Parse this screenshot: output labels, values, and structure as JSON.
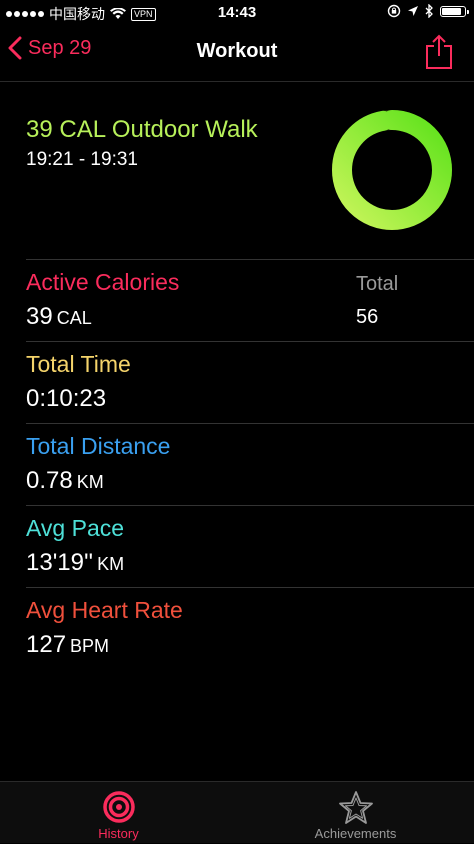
{
  "status_bar": {
    "carrier": "中国移动",
    "vpn": "VPN",
    "time": "14:43",
    "battery_level": 0.85
  },
  "nav": {
    "back_label": "Sep 29",
    "title": "Workout"
  },
  "summary": {
    "workout_name": "39 CAL Outdoor Walk",
    "time_range": "19:21 - 19:31",
    "ring_progress": 0.97
  },
  "metrics": {
    "active_calories": {
      "label": "Active Calories",
      "value": "39",
      "unit": "CAL",
      "total_label": "Total",
      "total_value": "56"
    },
    "total_time": {
      "label": "Total Time",
      "value": "0:10:23"
    },
    "total_distance": {
      "label": "Total Distance",
      "value": "0.78",
      "unit": "KM"
    },
    "avg_pace": {
      "label": "Avg Pace",
      "value": "13'19''",
      "unit": "KM"
    },
    "avg_heart_rate": {
      "label": "Avg Heart Rate",
      "value": "127",
      "unit": "BPM"
    }
  },
  "tabs": [
    {
      "label": "History",
      "icon": "history-icon"
    },
    {
      "label": "Achievements",
      "icon": "achievements-icon"
    }
  ],
  "colors": {
    "accent": "#fa2c5c",
    "move_green": "#b7f05a",
    "active_calories": "#fa2c5c",
    "total_time": "#f5d46b",
    "total_distance": "#3aa0f0",
    "avg_pace": "#4ee0d8",
    "avg_heart_rate": "#f0503c"
  }
}
